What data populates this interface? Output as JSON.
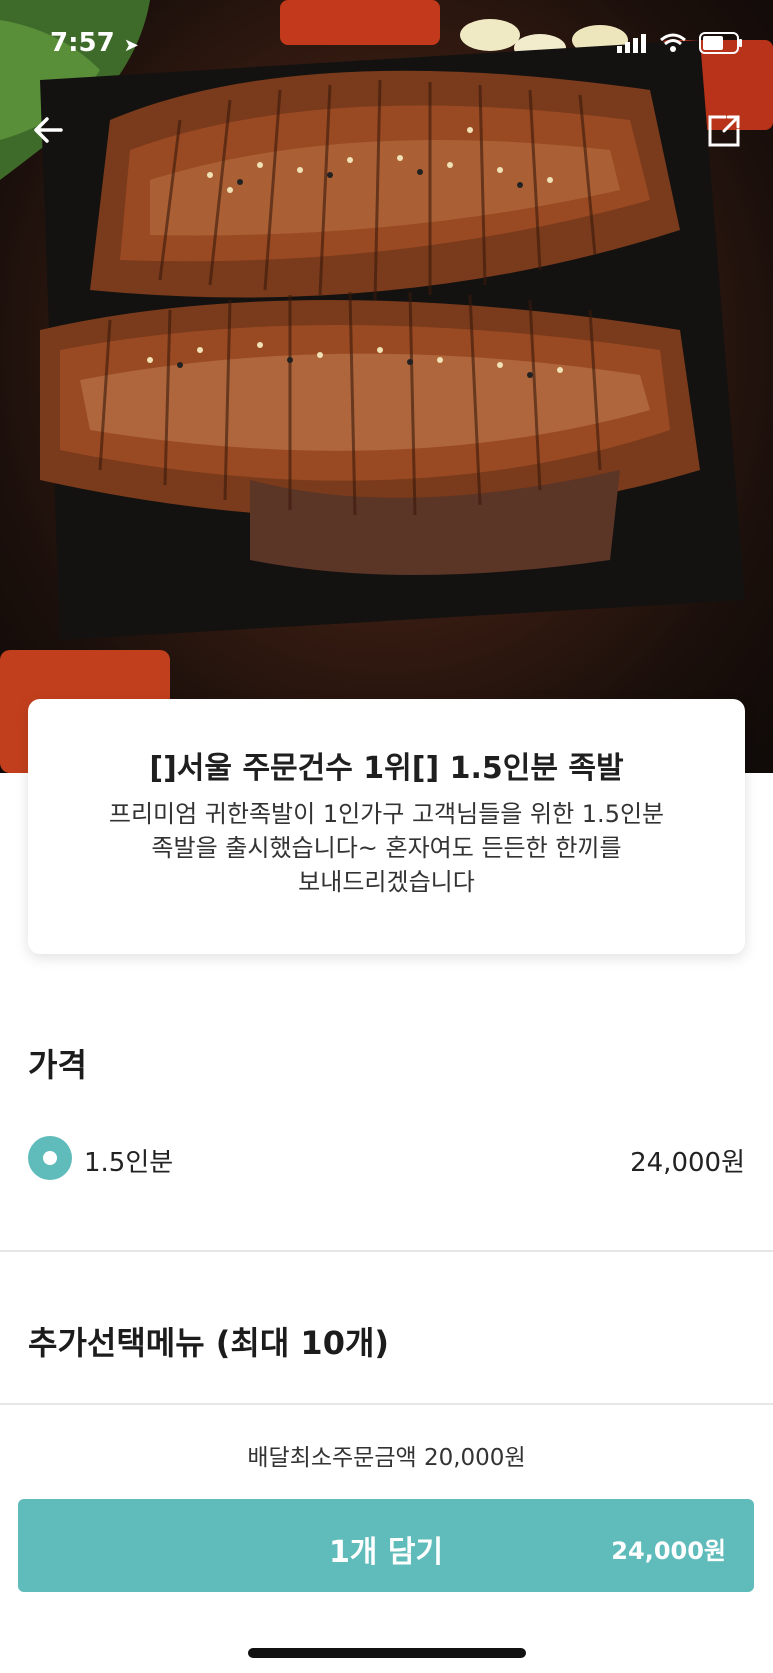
{
  "status_bar": {
    "time": "7:57"
  },
  "product": {
    "title": "[]서울 주문건수 1위[] 1.5인분 족발",
    "description_lines": [
      "프리미엄 귀한족발이 1인가구 고객님들을 위한 1.5인분",
      "족발을 출시했습니다~  혼자여도 든든한 한끼를",
      "보내드리겠습니다"
    ]
  },
  "price_section": {
    "title": "가격",
    "options": [
      {
        "label": "1.5인분",
        "price": "24,000원",
        "selected": true
      }
    ]
  },
  "addon_section": {
    "title": "추가선택메뉴 (최대 10개)"
  },
  "footer": {
    "min_order": "배달최소주문금액 20,000원",
    "cart_button_label": "1개 담기",
    "cart_button_price": "24,000원"
  },
  "colors": {
    "accent": "#5fbcbb"
  },
  "icons": {
    "back": "arrow-left-icon",
    "share": "share-icon",
    "location": "location-arrow-icon",
    "signal": "signal-icon",
    "wifi": "wifi-icon",
    "battery": "battery-icon"
  }
}
